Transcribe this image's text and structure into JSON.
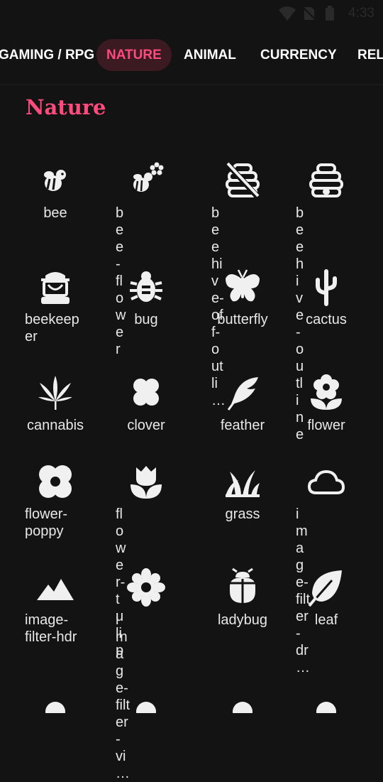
{
  "status_bar": {
    "time": "4:33",
    "icons": [
      "wifi-icon",
      "no-sim-icon",
      "battery-icon"
    ]
  },
  "tabs": [
    {
      "label": "GAMING / RPG",
      "active": false
    },
    {
      "label": "NATURE",
      "active": true
    },
    {
      "label": "ANIMAL",
      "active": false
    },
    {
      "label": "CURRENCY",
      "active": false
    },
    {
      "label": "RELIGION",
      "active": false
    }
  ],
  "section": {
    "title": "Nature"
  },
  "icons": [
    {
      "name": "bee",
      "label": "bee",
      "icon": "bee-icon"
    },
    {
      "name": "bee-flower",
      "label": "bee-\nflower",
      "icon": "bee-flower-icon"
    },
    {
      "name": "beehive-off-outline",
      "label": "beehive-\noff-outli…",
      "icon": "beehive-off-outline-icon"
    },
    {
      "name": "beehive-outline",
      "label": "beehive-\noutline",
      "icon": "beehive-outline-icon"
    },
    {
      "name": "beekeeper",
      "label": "beekeep\ner",
      "icon": "beekeeper-icon"
    },
    {
      "name": "bug",
      "label": "bug",
      "icon": "bug-icon"
    },
    {
      "name": "butterfly",
      "label": "butterfly",
      "icon": "butterfly-icon"
    },
    {
      "name": "cactus",
      "label": "cactus",
      "icon": "cactus-icon"
    },
    {
      "name": "cannabis",
      "label": "cannabis",
      "icon": "cannabis-icon"
    },
    {
      "name": "clover",
      "label": "clover",
      "icon": "clover-icon"
    },
    {
      "name": "feather",
      "label": "feather",
      "icon": "feather-icon"
    },
    {
      "name": "flower",
      "label": "flower",
      "icon": "flower-icon"
    },
    {
      "name": "flower-poppy",
      "label": "flower-\npoppy",
      "icon": "flower-poppy-icon"
    },
    {
      "name": "flower-tulip",
      "label": "flower-\ntulip",
      "icon": "flower-tulip-icon"
    },
    {
      "name": "grass",
      "label": "grass",
      "icon": "grass-icon"
    },
    {
      "name": "image-filter-drama",
      "label": "image-\nfilter-dr…",
      "icon": "cloud-icon"
    },
    {
      "name": "image-filter-hdr",
      "label": "image-\nfilter-hdr",
      "icon": "mountain-icon"
    },
    {
      "name": "image-filter-vintage",
      "label": "image-\nfilter-vi…",
      "icon": "vintage-flower-icon"
    },
    {
      "name": "ladybug",
      "label": "ladybug",
      "icon": "ladybug-icon"
    },
    {
      "name": "leaf",
      "label": "leaf",
      "icon": "leaf-icon"
    },
    {
      "name": "partial-1",
      "label": "",
      "icon": "partial-icon"
    },
    {
      "name": "partial-2",
      "label": "",
      "icon": "partial-icon"
    },
    {
      "name": "partial-3",
      "label": "",
      "icon": "partial-icon"
    },
    {
      "name": "partial-4",
      "label": "",
      "icon": "partial-icon"
    }
  ],
  "colors": {
    "background": "#131313",
    "accent": "#ff4a7d",
    "active_tab_bg": "#3b1a22",
    "text": "#f0f0f0"
  }
}
